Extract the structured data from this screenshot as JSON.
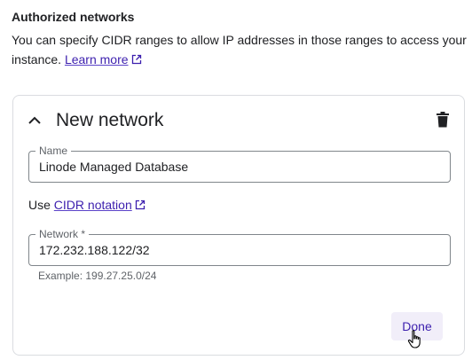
{
  "section": {
    "title": "Authorized networks",
    "description": "You can specify CIDR ranges to allow IP addresses in those ranges to access your instance.",
    "learn_more_link": "Learn more",
    "learn_more_icon": "open-in-new-icon"
  },
  "network_card": {
    "collapse_icon": "chevron-up-icon",
    "title": "New network",
    "delete_icon": "trash-icon",
    "name_field": {
      "label": "Name",
      "value": "Linode Managed Database"
    },
    "cidr_prefix": "Use",
    "cidr_link": "CIDR notation",
    "cidr_link_icon": "open-in-new-icon",
    "network_field": {
      "label": "Network *",
      "value": "172.232.188.122/32"
    },
    "hint": "Example: 199.27.25.0/24",
    "done_label": "Done"
  },
  "colors": {
    "link": "#3c1fae",
    "button_bg": "#f1eef9",
    "border": "#dadce0",
    "field_border": "#80868b"
  }
}
